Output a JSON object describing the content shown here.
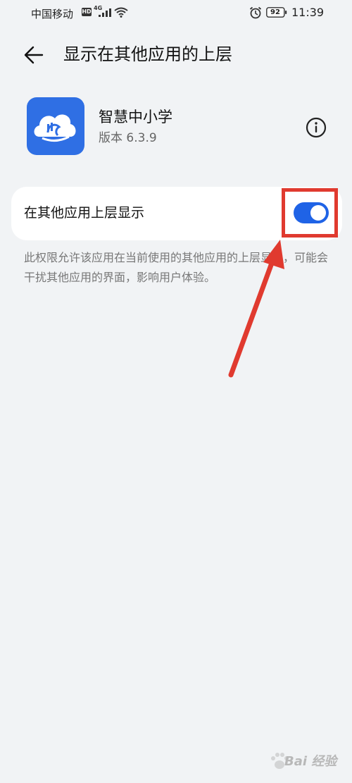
{
  "status_bar": {
    "carrier": "中国移动",
    "hd": "HD",
    "network": "4G",
    "battery": "92",
    "time": "11:39"
  },
  "header": {
    "title": "显示在其他应用的上层"
  },
  "app": {
    "name": "智慧中小学",
    "version": "版本 6.3.9"
  },
  "setting": {
    "label": "在其他应用上层显示",
    "toggle_on": true,
    "description": "此权限允许该应用在当前使用的其他应用的上层显示，可能会干扰其他应用的界面，影响用户体验。"
  },
  "watermark": {
    "text": "Bai 经验"
  },
  "colors": {
    "accent": "#1f63e6",
    "app_icon_bg": "#2f6fe4",
    "annotation_red": "#e03a2f",
    "background": "#f1f3f5"
  }
}
